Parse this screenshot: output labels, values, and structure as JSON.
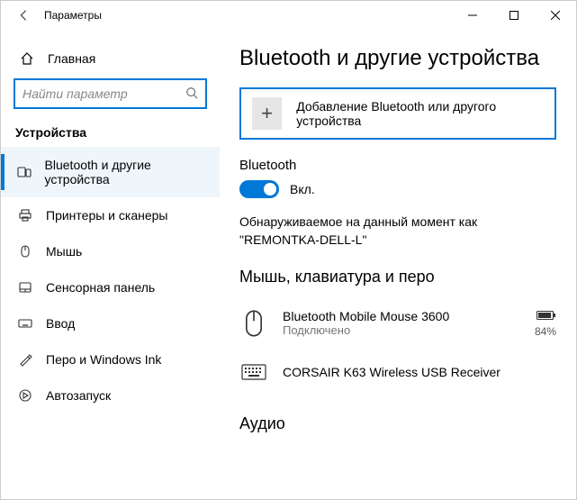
{
  "window": {
    "title": "Параметры"
  },
  "sidebar": {
    "home": "Главная",
    "search_placeholder": "Найти параметр",
    "group": "Устройства",
    "items": [
      {
        "label": "Bluetooth и другие устройства",
        "selected": true,
        "icon": "devices"
      },
      {
        "label": "Принтеры и сканеры",
        "selected": false,
        "icon": "printer"
      },
      {
        "label": "Мышь",
        "selected": false,
        "icon": "mouse"
      },
      {
        "label": "Сенсорная панель",
        "selected": false,
        "icon": "touchpad"
      },
      {
        "label": "Ввод",
        "selected": false,
        "icon": "keyboard"
      },
      {
        "label": "Перо и Windows Ink",
        "selected": false,
        "icon": "pen"
      },
      {
        "label": "Автозапуск",
        "selected": false,
        "icon": "autoplay"
      }
    ]
  },
  "main": {
    "title": "Bluetooth и другие устройства",
    "add_device": "Добавление Bluetooth или другого устройства",
    "bluetooth": {
      "label": "Bluetooth",
      "state": "Вкл.",
      "discoverable": "Обнаруживаемое на данный момент как \"REMONTKA-DELL-L\""
    },
    "section_peripherals": "Мышь, клавиатура и перо",
    "devices": [
      {
        "name": "Bluetooth Mobile Mouse 3600",
        "status": "Подключено",
        "battery": "84%",
        "icon": "mouse"
      },
      {
        "name": "CORSAIR K63 Wireless USB Receiver",
        "status": "",
        "battery": "",
        "icon": "keyboard"
      }
    ],
    "section_audio": "Аудио"
  }
}
